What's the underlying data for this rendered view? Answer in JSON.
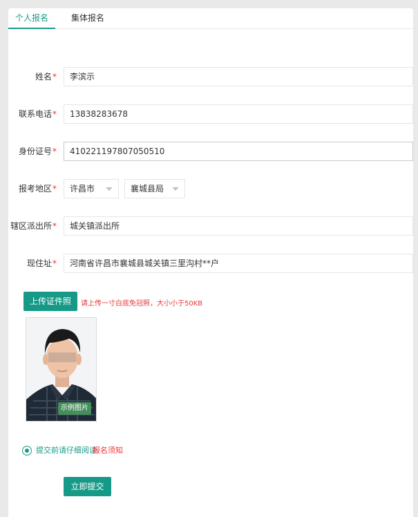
{
  "tabs": [
    {
      "label": "个人报名",
      "active": true
    },
    {
      "label": "集体报名",
      "active": false
    }
  ],
  "form": {
    "name": {
      "label": "姓名",
      "value": "李滨示"
    },
    "phone": {
      "label": "联系电话",
      "value": "13838283678"
    },
    "id_number": {
      "label": "身份证号",
      "value": "410221197807050510"
    },
    "region": {
      "label": "报考地区",
      "city": "许昌市",
      "county": "襄城县局"
    },
    "police_station": {
      "label": "辖区派出所",
      "value": "城关镇派出所"
    },
    "address": {
      "label": "现住址",
      "value": "河南省许昌市襄城县城关镇三里沟村**户"
    },
    "required_mark": "*"
  },
  "upload": {
    "button_label": "上传证件照",
    "hint": "请上传一寸白底免冠照，大小小于50KB",
    "sample_badge": "示例图片"
  },
  "agreement": {
    "text": "提交前请仔细阅读",
    "link": "报名须知",
    "checked": true
  },
  "submit_label": "立即提交",
  "colors": {
    "accent": "#169a87",
    "required": "#e33333",
    "background": "#e9e9e9"
  }
}
